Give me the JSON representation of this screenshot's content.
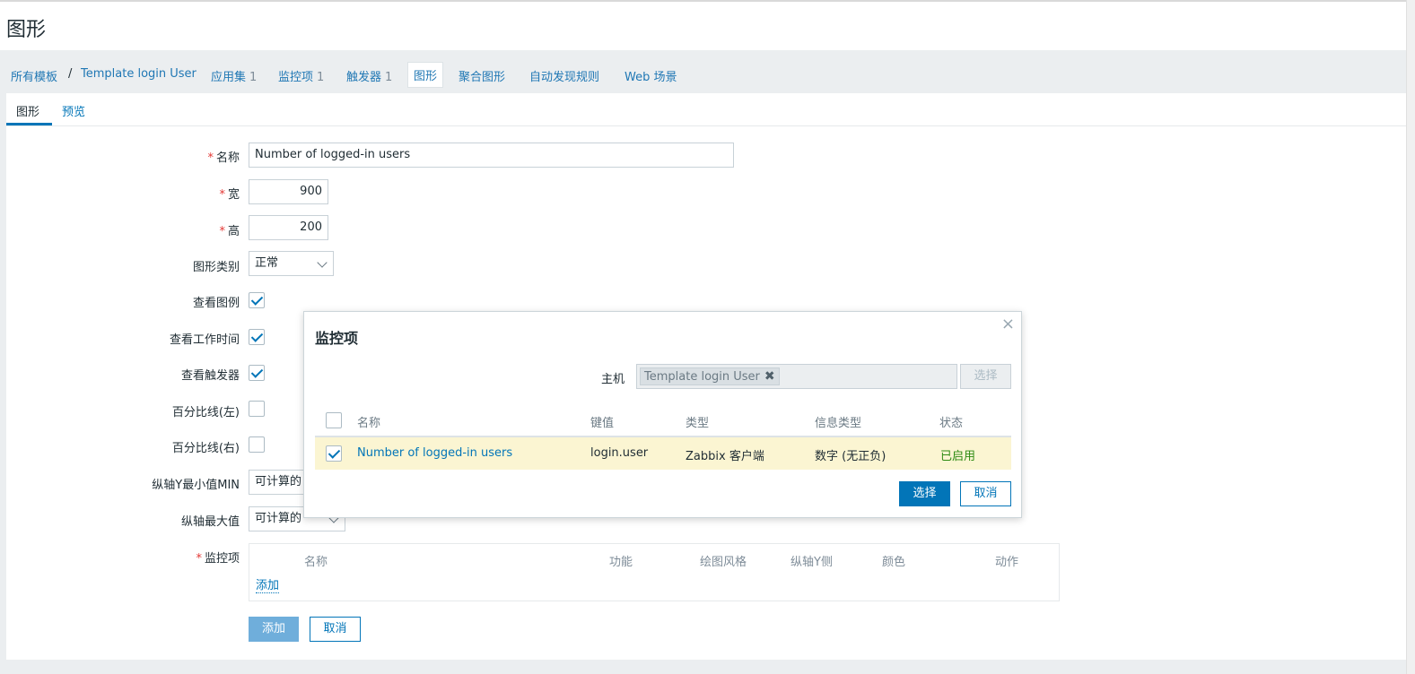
{
  "page": {
    "title": "图形"
  },
  "nav": {
    "all_templates": "所有模板",
    "separator": "/",
    "template": "Template login User",
    "apps": {
      "label": "应用集",
      "count": "1"
    },
    "items": {
      "label": "监控项",
      "count": "1"
    },
    "triggers": {
      "label": "触发器",
      "count": "1"
    },
    "graphs": "图形",
    "screens": "聚合图形",
    "discovery": "自动发现规则",
    "web": "Web 场景"
  },
  "tabs": {
    "graph": "图形",
    "preview": "预览"
  },
  "form": {
    "required_mark": "*",
    "name_label": "名称",
    "name_value": "Number of logged-in users",
    "width_label": "宽",
    "width_value": "900",
    "height_label": "高",
    "height_value": "200",
    "graph_type_label": "图形类别",
    "graph_type_value": "正常",
    "show_legend_label": "查看图例",
    "show_working_time_label": "查看工作时间",
    "show_triggers_label": "查看触发器",
    "percentile_left_label": "百分比线(左)",
    "percentile_right_label": "百分比线(右)",
    "ymin_label": "纵轴Y最小值MIN",
    "ymin_value": "可计算的",
    "ymax_label": "纵轴最大值",
    "ymax_value": "可计算的",
    "items_label": "监控项",
    "items_headers": [
      "名称",
      "功能",
      "绘图风格",
      "纵轴Y侧",
      "颜色",
      "动作"
    ],
    "items_add": "添加",
    "add_button": "添加",
    "cancel_button": "取消"
  },
  "modal": {
    "title": "监控项",
    "close": "×",
    "host_label": "主机",
    "host_chip": "Template login User",
    "host_chip_remove": "✖",
    "select_host_button": "选择",
    "columns": {
      "name": "名称",
      "key": "键值",
      "type": "类型",
      "info_type": "信息类型",
      "status": "状态"
    },
    "row": {
      "name": "Number of logged-in users",
      "key": "login.user",
      "type": "Zabbix 客户端",
      "info_type": "数字 (无正负)",
      "status": "已启用"
    },
    "select_button": "选择",
    "cancel_button": "取消"
  },
  "colors": {
    "accent": "#0275b8",
    "status_enabled": "#2e8b13",
    "row_highlight": "#fbf5d2",
    "required": "#e33734"
  }
}
